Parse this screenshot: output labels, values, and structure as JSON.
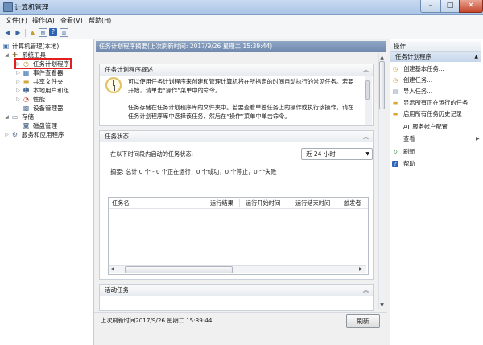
{
  "window": {
    "title": "计算机管理"
  },
  "window_buttons": {
    "minimize": "–",
    "maximize": "□",
    "close": "✕"
  },
  "menu": [
    "文件(F)",
    "操作(A)",
    "查看(V)",
    "帮助(H)"
  ],
  "tree": [
    {
      "label": "计算机管理(本地)",
      "icon": "computer-icon"
    },
    {
      "label": "系统工具",
      "icon": "tools-icon"
    },
    {
      "label": "任务计划程序",
      "icon": "clock-icon"
    },
    {
      "label": "事件查看器",
      "icon": "event-viewer-icon"
    },
    {
      "label": "共享文件夹",
      "icon": "shared-folder-icon"
    },
    {
      "label": "本地用户和组",
      "icon": "users-icon"
    },
    {
      "label": "性能",
      "icon": "performance-icon"
    },
    {
      "label": "设备管理器",
      "icon": "device-manager-icon"
    },
    {
      "label": "存储",
      "icon": "storage-icon"
    },
    {
      "label": "磁盘管理",
      "icon": "disk-icon"
    },
    {
      "label": "服务和应用程序",
      "icon": "services-icon"
    }
  ],
  "center": {
    "header": "任务计划程序摘要(上次刷新时间: 2017/9/26 星期二 15:39:44)",
    "overview": {
      "title": "任务计划程序概述",
      "para1_line1": "可以使用任务计划程序来创建和管理计算机将在所指定的时间自动执行的常见任务。若要",
      "para1_line2": "开始，请单击“操作”菜单中的命令。",
      "para2_line1": "任务存储在任务计划程序库的文件夹中。若要查看单独任务上的操作或执行该操作，请在",
      "para2_line2": "任务计划程序库中选择该任务，然后在“操作”菜单中单击命令。"
    },
    "status": {
      "title": "任务状态",
      "prompt": "在以下时间段内启动的任务状态:",
      "range": "近 24 小时",
      "summary": "摘要: 总计 0 个 - 0 个正在运行，0 个成功，0 个停止，0 个失败",
      "columns": [
        "任务名",
        "运行结果",
        "运行开始时间",
        "运行结束时间",
        "触发者"
      ]
    },
    "active": {
      "title": "活动任务"
    },
    "footer": {
      "last_refresh": "上次刷新时间2017/9/26 星期二 15:39:44",
      "refresh_button": "刷新"
    }
  },
  "actions": {
    "title": "操作",
    "group": "任务计划程序",
    "items": [
      {
        "label": "创建基本任务...",
        "icon": "create-basic-task-icon"
      },
      {
        "label": "创建任务...",
        "icon": "create-task-icon"
      },
      {
        "label": "导入任务...",
        "icon": "import-task-icon"
      },
      {
        "label": "显示所有正在运行的任务",
        "icon": "running-tasks-icon"
      },
      {
        "label": "启用所有任务历史记录",
        "icon": "history-icon"
      },
      {
        "label": "AT 服务帐户配置",
        "icon": "at-service-icon"
      },
      {
        "label": "查看",
        "icon": "view-icon"
      },
      {
        "label": "刷新",
        "icon": "refresh-icon"
      },
      {
        "label": "帮助",
        "icon": "help-icon"
      }
    ]
  },
  "colors": {
    "accent": "#7089ad",
    "highlight_box": "#e02020",
    "group_bg": "#c6d6eb"
  }
}
